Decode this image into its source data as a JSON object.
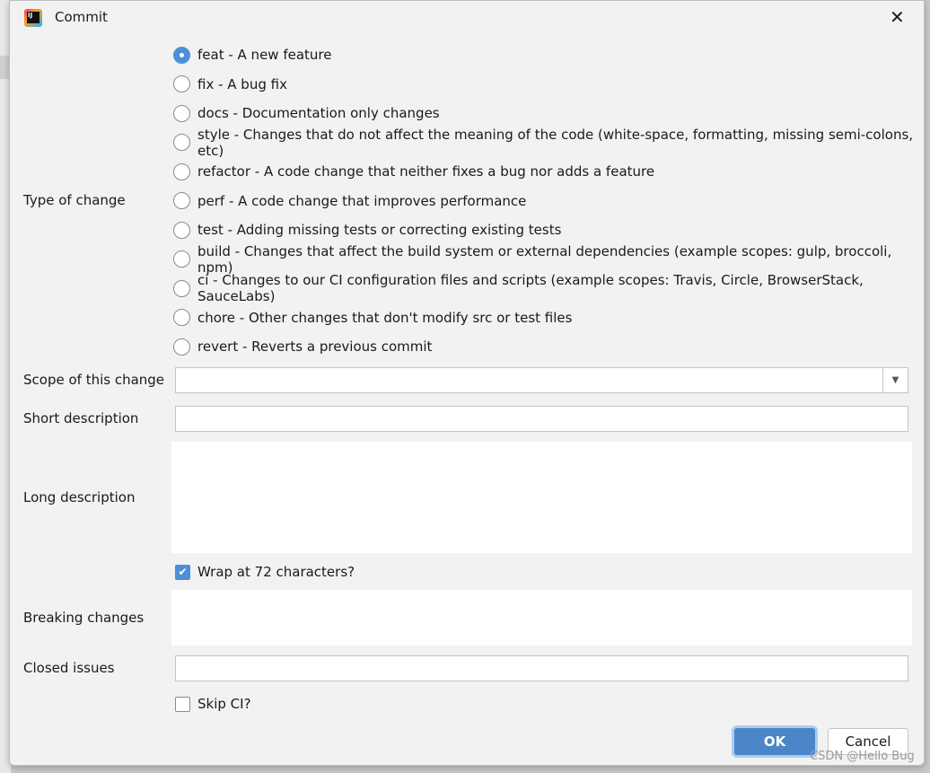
{
  "dialog": {
    "title": "Commit"
  },
  "type_of_change": {
    "label": "Type of change",
    "selected": 0,
    "options": [
      "feat - A new feature",
      "fix - A bug fix",
      "docs - Documentation only changes",
      "style - Changes that do not affect the meaning of the code (white-space, formatting, missing semi-colons, etc)",
      "refactor - A code change that neither fixes a bug nor adds a feature",
      "perf - A code change that improves performance",
      "test - Adding missing tests or correcting existing tests",
      "build - Changes that affect the build system or external dependencies (example scopes: gulp, broccoli, npm)",
      "ci - Changes to our CI configuration files and scripts (example scopes: Travis, Circle, BrowserStack, SauceLabs)",
      "chore - Other changes that don't modify src or test files",
      "revert - Reverts a previous commit"
    ]
  },
  "fields": {
    "scope": "Scope of this change",
    "short": "Short description",
    "long": "Long description",
    "wrap": "Wrap at 72 characters?",
    "wrap_checked": true,
    "breaking": "Breaking changes",
    "closed": "Closed issues",
    "skip_ci": "Skip CI?",
    "skip_ci_checked": false
  },
  "buttons": {
    "ok": "OK",
    "cancel": "Cancel"
  },
  "watermark": "CSDN @Hello Bug"
}
